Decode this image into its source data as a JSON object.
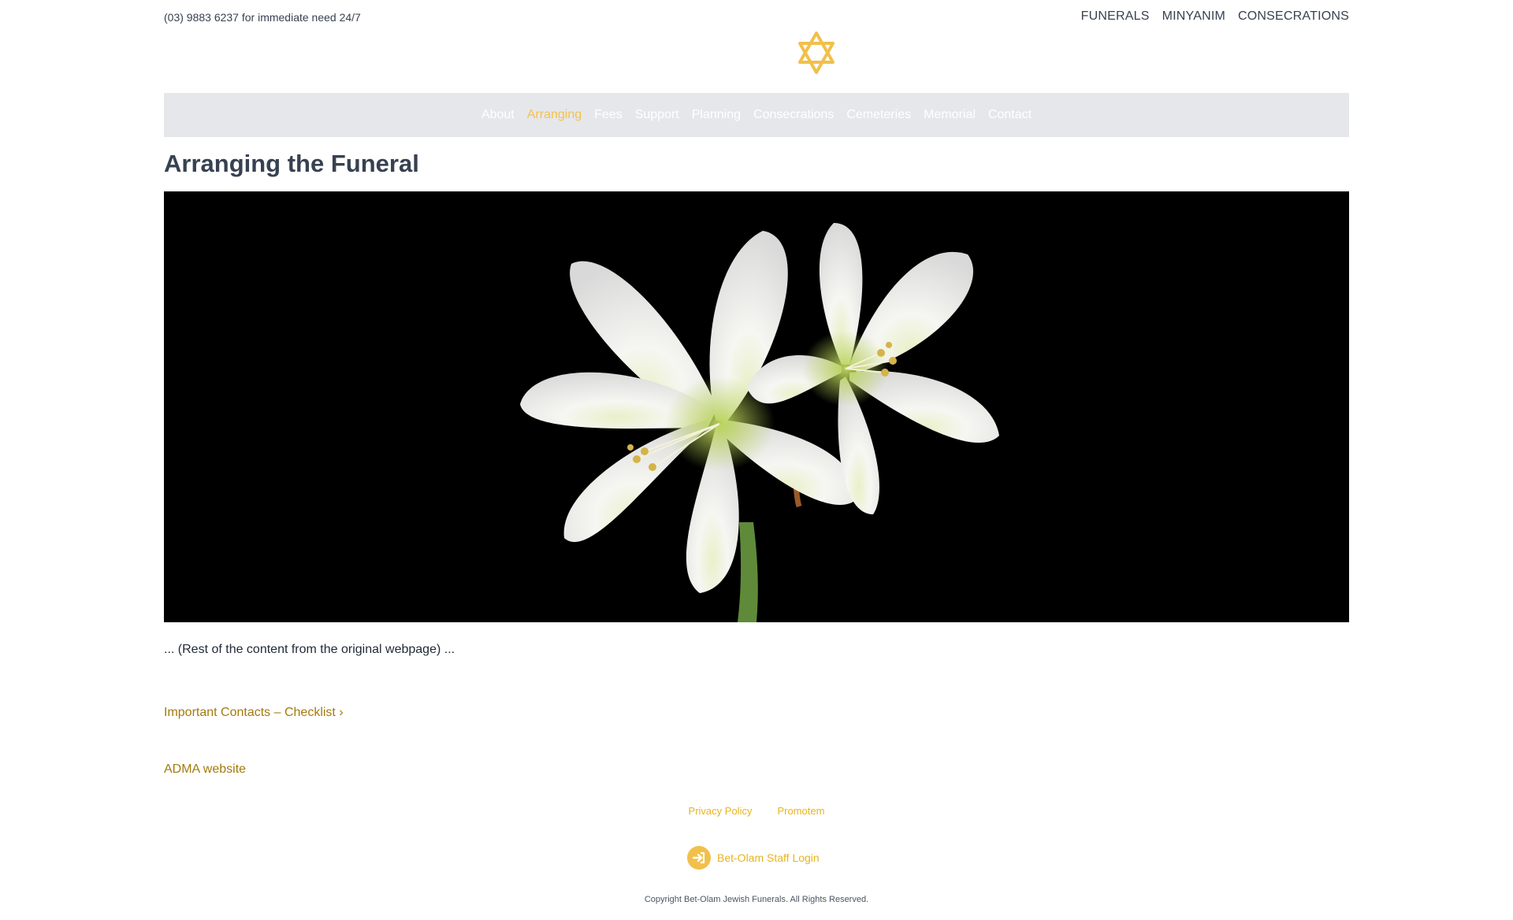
{
  "topbar": {
    "phone_text": "(03) 9883 6237 for immediate need 24/7",
    "links": [
      "FUNERALS",
      "MINYANIM",
      "CONSECRATIONS"
    ]
  },
  "logo": {
    "icon": "star-of-david-icon",
    "color": "#f1c04b"
  },
  "nav": {
    "items": [
      "About",
      "Arranging",
      "Fees",
      "Support",
      "Planning",
      "Consecrations",
      "Cemeteries",
      "Memorial",
      "Contact"
    ],
    "active": "Arranging",
    "background": "#e5e7eb",
    "active_color": "#f5c24a"
  },
  "page": {
    "title": "Arranging the Funeral",
    "body_text": "... (Rest of the content from the original webpage) ...",
    "links": {
      "checklist": "Important Contacts – Checklist ›",
      "adma": "ADMA website"
    }
  },
  "footer": {
    "links": [
      "Privacy Policy",
      "Promotem"
    ],
    "staff_login": "Bet-Olam Staff Login",
    "staff_login_icon": "sign-in-icon",
    "copyright": "Copyright Bet-Olam Jewish Funerals. All Rights Reserved."
  },
  "colors": {
    "text": "#374151",
    "link_gold": "#a47a0c",
    "footer_gold": "#e6b422"
  }
}
